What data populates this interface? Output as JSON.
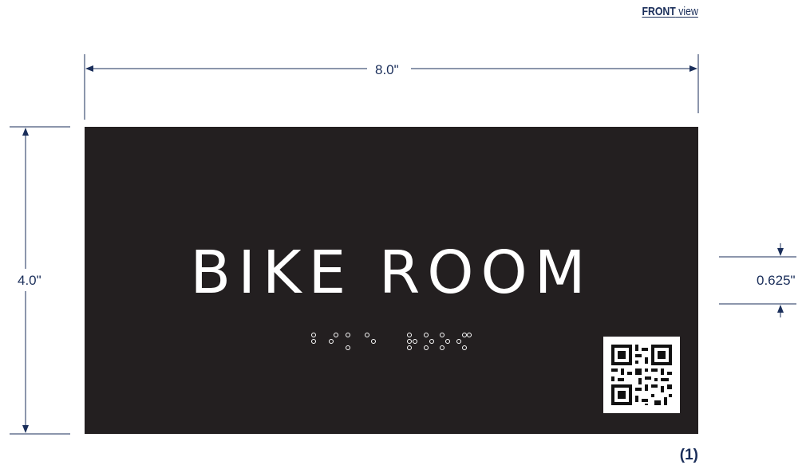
{
  "view_label": {
    "bold": "FRONT",
    "rest": " view"
  },
  "sign": {
    "title": "BIKE ROOM",
    "background_color": "#231f20",
    "text_color": "#ffffff",
    "has_braille": true,
    "has_qr_code": true
  },
  "dimensions": {
    "width": "8.0\"",
    "height": "4.0\"",
    "letter_height": "0.625\""
  },
  "quantity": "(1)",
  "colors": {
    "dimension_lines": "#1a2e5a"
  }
}
